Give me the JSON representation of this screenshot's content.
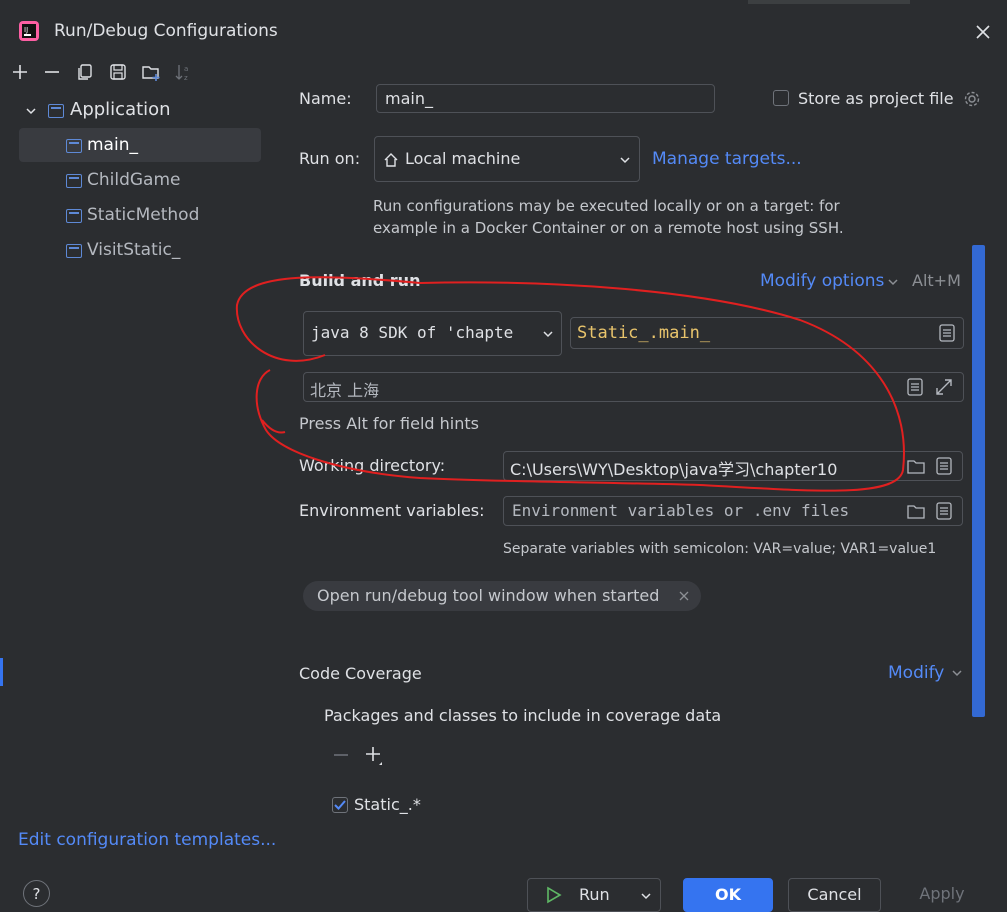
{
  "window": {
    "title": "Run/Debug Configurations"
  },
  "toolbar": {
    "icons": [
      "plus-icon",
      "minus-icon",
      "copy-icon",
      "save-icon",
      "folder-add-icon",
      "sort-az-icon"
    ]
  },
  "tree": {
    "group": "Application",
    "items": [
      {
        "label": "main_",
        "selected": true
      },
      {
        "label": "ChildGame",
        "selected": false
      },
      {
        "label": "StaticMethod",
        "selected": false
      },
      {
        "label": "VisitStatic_",
        "selected": false
      }
    ]
  },
  "form": {
    "name_label": "Name:",
    "name_value": "main_",
    "store_label": "Store as project file",
    "run_on_label": "Run on:",
    "run_on_value": "Local machine",
    "manage_targets": "Manage targets...",
    "run_on_help_1": "Run configurations may be executed locally or on a target: for",
    "run_on_help_2": "example in a Docker Container or on a remote host using SSH.",
    "build_run_title": "Build and run",
    "modify_options": "Modify options",
    "modify_shortcut": "Alt+M",
    "sdk_value": "java 8 SDK of 'chapte",
    "main_class": "Static_.main_",
    "program_args": "北京 上海",
    "field_hints": "Press Alt for field hints",
    "working_dir_label": "Working directory:",
    "working_dir_value": "C:\\Users\\WY\\Desktop\\java学习\\chapter10",
    "env_label": "Environment variables:",
    "env_placeholder": "Environment variables or .env files",
    "env_help": "Separate variables with semicolon: VAR=value; VAR1=value1",
    "tag_label": "Open run/debug tool window when started",
    "coverage_title": "Code Coverage",
    "coverage_modify": "Modify",
    "coverage_help": "Packages and classes to include in coverage data",
    "coverage_item": "Static_.*"
  },
  "footer": {
    "edit_templates": "Edit configuration templates...",
    "help": "?",
    "run": "Run",
    "ok": "OK",
    "cancel": "Cancel",
    "apply": "Apply"
  },
  "colors": {
    "accent": "#548af7",
    "annotation": "#e02020",
    "background": "#2b2d30",
    "selection": "#393b40"
  }
}
